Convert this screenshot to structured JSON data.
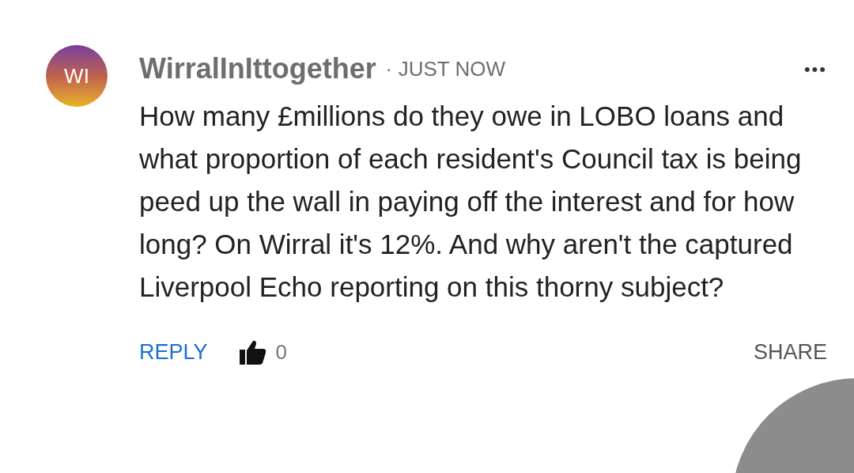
{
  "comment": {
    "avatar_initials": "WI",
    "author": "WirralInIttogether",
    "separator": "·",
    "time": "JUST NOW",
    "menu": "•••",
    "body": "How many £millions do they owe in LOBO loans and what proportion of each resident's Council tax is being peed up the wall in paying off the interest and for how long? On Wirral it's 12%. And why aren't the captured Liverpool Echo reporting on this thorny subject?",
    "reply": "REPLY",
    "likes": "0",
    "share": "SHARE"
  }
}
